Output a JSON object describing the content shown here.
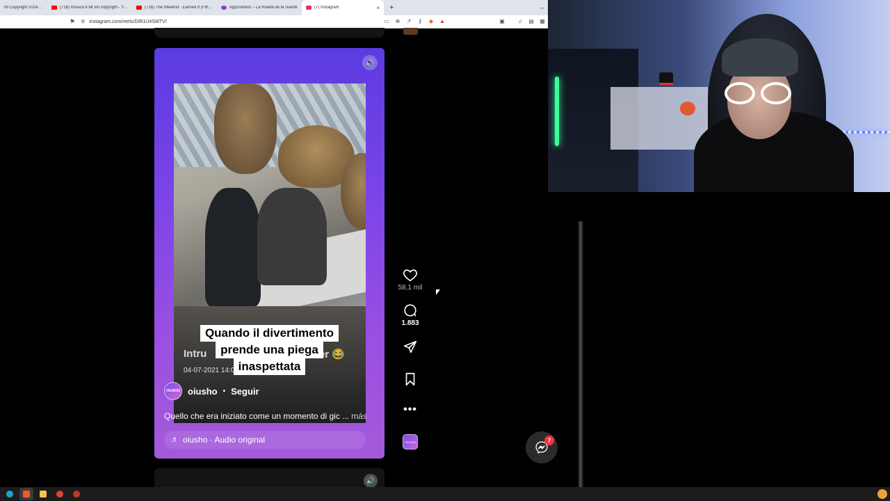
{
  "browser": {
    "tabs": [
      {
        "title": "IN Copyright 2024 (Ki",
        "favicon_color": "#ffffff"
      },
      {
        "title": "(718) música 8 bit sin copyright - YouTube",
        "favicon_color": "#ff0000"
      },
      {
        "title": "(716) The Weeknd - Earned It (Fifty Shades",
        "favicon_color": "#ff0000"
      },
      {
        "title": "AppSorteos – La Ruleta de la Suerte",
        "favicon_color": "#8e3ccf"
      },
      {
        "title": "(7) Instagram",
        "favicon_color": "#e1306c",
        "active": true
      }
    ],
    "tab_close_glyph": "×",
    "new_tab_glyph": "+",
    "minimize_glyph": "–",
    "url": "instagram.com/reels/DIR1U4SI8TV/"
  },
  "reel": {
    "caption_lines": [
      "Quando il divertimento",
      "prende una piega",
      "inaspettata"
    ],
    "burned_text_left": "Intru",
    "burned_text_right": "er 😂",
    "video_timestamp": "04-07-2021 14:02:25",
    "author": {
      "avatar_text": "OIUSHO",
      "username": "oiusho",
      "follow_label": "Seguir"
    },
    "description": "Quello che era iniziato come un momento di gic ...",
    "more_label": "más",
    "audio": "oiusho · Audio original"
  },
  "actions": {
    "likes": "58,1 mil",
    "comments": "1.883",
    "more_glyph": "•••",
    "audio_thumb_text": "OIUSHO"
  },
  "messages": {
    "badge": "7"
  },
  "colors": {
    "accent_badge": "#ff3040",
    "reel_gradient_top": "#5b3be0",
    "reel_gradient_bottom": "#a35ad9"
  }
}
